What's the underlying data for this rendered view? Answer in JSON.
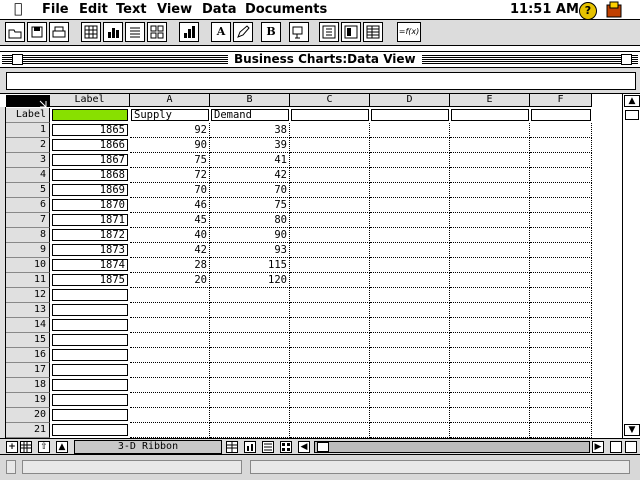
{
  "menubar": {
    "items": [
      "File",
      "Edit",
      "Text",
      "View",
      "Data",
      "Documents"
    ],
    "clock": "11:51 AM",
    "help_label": "?"
  },
  "toolbar": {
    "buttons": [
      "open-folder-icon",
      "save-icon",
      "print-icon",
      "grid-view-icon",
      "bar-chart-icon",
      "list-icon",
      "table-layout-icon",
      "chart-type-icon",
      "text-format-icon",
      "pencil-edit-icon",
      "bold-icon",
      "copy-format-icon",
      "data-sheet-icon",
      "layout-icon",
      "table-icon",
      "function-icon"
    ],
    "bold_label": "B",
    "function_label": "=f(x)",
    "font_label": "A"
  },
  "window": {
    "title": "Business Charts:Data View"
  },
  "entry": {
    "value": ""
  },
  "grid": {
    "corner_label": "",
    "label_header": "Label",
    "columns": [
      "A",
      "B",
      "C",
      "D",
      "E",
      "F"
    ],
    "label_row_header": "Label",
    "series_labels": [
      "Supply",
      "Demand",
      "",
      "",
      "",
      ""
    ],
    "rows": [
      {
        "n": "1",
        "label": "1865",
        "a": "92",
        "b": "38"
      },
      {
        "n": "2",
        "label": "1866",
        "a": "90",
        "b": "39"
      },
      {
        "n": "3",
        "label": "1867",
        "a": "75",
        "b": "41"
      },
      {
        "n": "4",
        "label": "1868",
        "a": "72",
        "b": "42"
      },
      {
        "n": "5",
        "label": "1869",
        "a": "70",
        "b": "70"
      },
      {
        "n": "6",
        "label": "1870",
        "a": "46",
        "b": "75"
      },
      {
        "n": "7",
        "label": "1871",
        "a": "45",
        "b": "80"
      },
      {
        "n": "8",
        "label": "1872",
        "a": "40",
        "b": "90"
      },
      {
        "n": "9",
        "label": "1873",
        "a": "42",
        "b": "93"
      },
      {
        "n": "10",
        "label": "1874",
        "a": "28",
        "b": "115"
      },
      {
        "n": "11",
        "label": "1875",
        "a": "20",
        "b": "120"
      },
      {
        "n": "12",
        "label": "",
        "a": "",
        "b": ""
      },
      {
        "n": "13",
        "label": "",
        "a": "",
        "b": ""
      },
      {
        "n": "14",
        "label": "",
        "a": "",
        "b": ""
      },
      {
        "n": "15",
        "label": "",
        "a": "",
        "b": ""
      },
      {
        "n": "16",
        "label": "",
        "a": "",
        "b": ""
      },
      {
        "n": "17",
        "label": "",
        "a": "",
        "b": ""
      },
      {
        "n": "18",
        "label": "",
        "a": "",
        "b": ""
      },
      {
        "n": "19",
        "label": "",
        "a": "",
        "b": ""
      },
      {
        "n": "20",
        "label": "",
        "a": "",
        "b": ""
      },
      {
        "n": "21",
        "label": "",
        "a": "",
        "b": ""
      }
    ],
    "selected_cell_color": "#88e000"
  },
  "bottombar": {
    "chart_type": "3-D Ribbon",
    "add_label": "+"
  }
}
